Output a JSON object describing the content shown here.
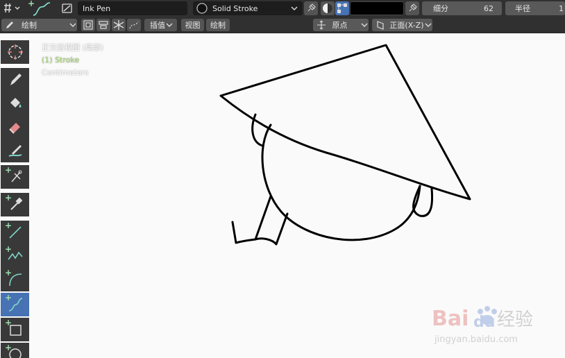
{
  "header": {
    "brush_name": "Ink Pen",
    "material_name": "Solid Stroke",
    "subdivide_label": "细分",
    "subdivide_value": "62",
    "radius_label": "半径",
    "radius_value": "1"
  },
  "subheader": {
    "mode_label": "绘制",
    "interpolate_label": "插值",
    "view_menu": "视图",
    "draw_menu": "绘制",
    "origin_label": "原点",
    "plane_label": "正面(X-Z)"
  },
  "viewport": {
    "view_name": "正交后视图 (局部)",
    "object_name": "(1) Stroke",
    "units": "Centimeters"
  },
  "watermark": {
    "brand": "Bai",
    "brand2": "du",
    "service": "经验",
    "url": "jingyan.baidu.com"
  },
  "colors": {
    "header_bg": "#303030",
    "active_tool": "#4772b3",
    "viewport_bg": "#fafafa",
    "object_name": "#a3d56a",
    "stroke": "#000000"
  }
}
